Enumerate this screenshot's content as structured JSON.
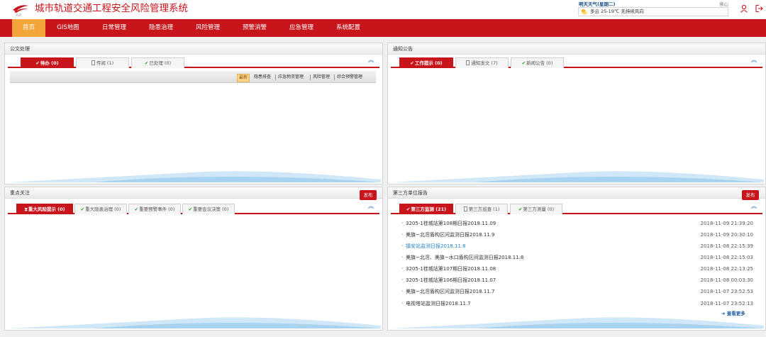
{
  "app": {
    "title": "城市轨道交通工程安全风险管理系统",
    "logo_text": "轨道",
    "accent": "#c8151b",
    "active_nav": "#f4a53a"
  },
  "weather": {
    "title": "明天天气(星期二)",
    "city": "佛山",
    "desc": "多云 25-19℃ 无持续风向"
  },
  "header_icons": [
    "user-icon",
    "logout-icon"
  ],
  "nav": [
    "首页",
    "GIS地图",
    "日常管理",
    "隐患治理",
    "风险管理",
    "预警消警",
    "应急管理",
    "系统配置"
  ],
  "panels": {
    "gongwen": {
      "title": "公文处理",
      "tabs": [
        "待办 (0)",
        "传阅 (1)",
        "已处理 (0)"
      ],
      "subnav": [
        "最新",
        "隐患排查",
        "应急物资管理",
        "风险管理",
        "综合预警管理"
      ]
    },
    "tongzhi": {
      "title": "通知公告",
      "tabs": [
        "工作提示 (0)",
        "通知发文 (7)",
        "新闻公告 (0)"
      ]
    },
    "zhongdian": {
      "title": "重点关注",
      "publish": "发布",
      "tabs": [
        "重大风险提示 (0)",
        "重大隐患治理 (0)",
        "重要预警事件 (0)",
        "重要会议决策 (0)"
      ]
    },
    "disanfang": {
      "title": "第三方单位报告",
      "publish": "发布",
      "tabs": [
        "第三方监测 (21)",
        "第三方巡查 (1)",
        "第三方测量 (0)"
      ],
      "rows": [
        {
          "title": "3205-1桂城站第108期日报2018.11.09",
          "date": "2018-11-09 21:39:20"
        },
        {
          "title": "美旗~北滘盾构区间监测日报2018.11.9",
          "date": "2018-11-09 20:30:10"
        },
        {
          "title": "镇安站监测日报2018.11.8",
          "date": "2018-11-08 22:15:39",
          "link": "#2a86c9"
        },
        {
          "title": "美旗~北滘、美旗~水口盾构区间监测日报2018.11.8",
          "date": "2018-11-08 22:15:03"
        },
        {
          "title": "3205-1桂城站第107期日报2018.11.08",
          "date": "2018-11-08 22:13:25"
        },
        {
          "title": "3205-1桂城站第106期日报2018.11.07",
          "date": "2018-11-08 00:03:30"
        },
        {
          "title": "美旗~北滘盾构区间监测日报2018.11.7",
          "date": "2018-11-07 23:52:53"
        },
        {
          "title": "电视塔站监测日报2018.11.7",
          "date": "2018-11-07 23:52:13"
        }
      ],
      "more": "查看更多"
    }
  }
}
